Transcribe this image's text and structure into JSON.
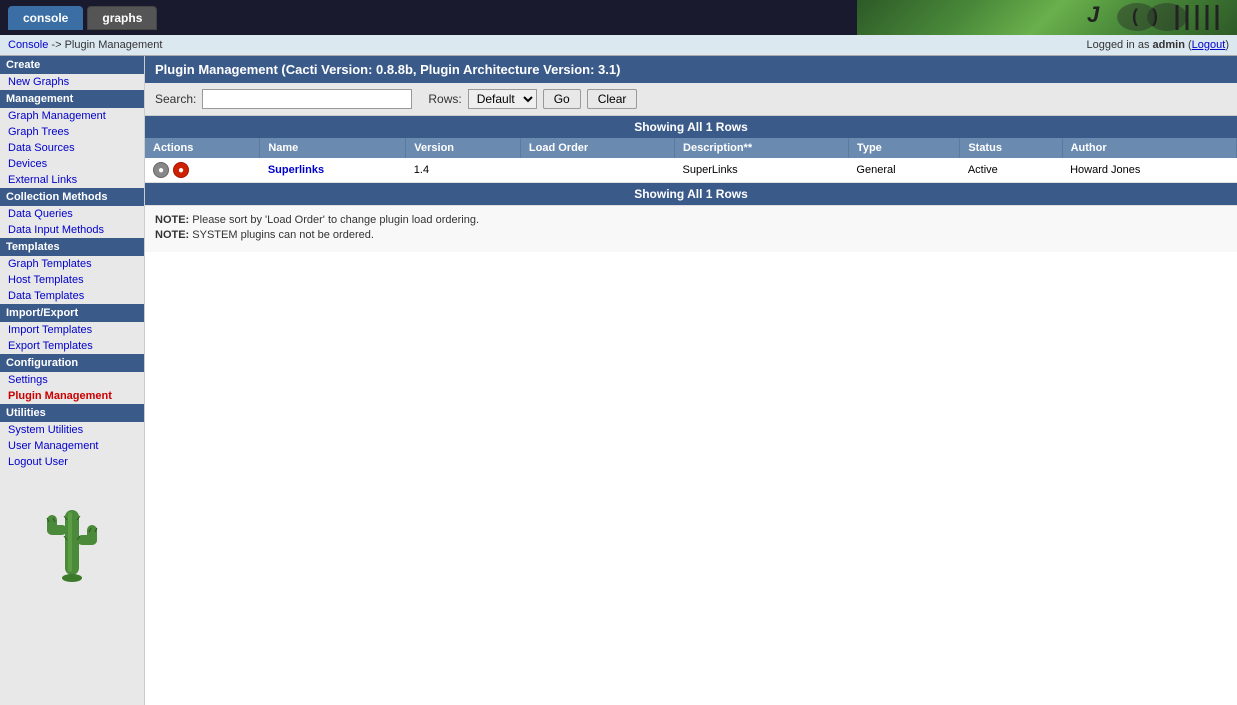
{
  "header": {
    "tab_console": "console",
    "tab_graphs": "graphs"
  },
  "breadcrumb": {
    "home": "Console",
    "separator": " -> ",
    "current": "Plugin Management"
  },
  "login": {
    "text": "Logged in as ",
    "username": "admin",
    "logout_label": "Logout"
  },
  "page_title": "Plugin Management (Cacti Version: 0.8.8b, Plugin Architecture Version: 3.1)",
  "search": {
    "label": "Search:",
    "placeholder": "",
    "rows_label": "Rows:",
    "rows_default": "Default",
    "go_label": "Go",
    "clear_label": "Clear"
  },
  "table": {
    "showing_label": "Showing All 1 Rows",
    "columns": [
      "Actions",
      "Name",
      "Version",
      "Load Order",
      "Description**",
      "Type",
      "Status",
      "Author"
    ],
    "rows": [
      {
        "name": "Superlinks",
        "version": "1.4",
        "load_order": "",
        "description": "SuperLinks",
        "type": "General",
        "status": "Active",
        "author": "Howard Jones"
      }
    ]
  },
  "notes": [
    "NOTE: Please sort by 'Load Order' to change plugin load ordering.",
    "NOTE: SYSTEM plugins can not be ordered."
  ],
  "sidebar": {
    "create_header": "Create",
    "new_graphs": "New Graphs",
    "management_header": "Management",
    "graph_management": "Graph Management",
    "graph_trees": "Graph Trees",
    "data_sources": "Data Sources",
    "devices": "Devices",
    "external_links": "External Links",
    "collection_header": "Collection Methods",
    "data_queries": "Data Queries",
    "data_input_methods": "Data Input Methods",
    "templates_header": "Templates",
    "graph_templates": "Graph Templates",
    "host_templates": "Host Templates",
    "data_templates": "Data Templates",
    "import_export_header": "Import/Export",
    "import_templates": "Import Templates",
    "export_templates": "Export Templates",
    "configuration_header": "Configuration",
    "settings": "Settings",
    "plugin_management": "Plugin Management",
    "utilities_header": "Utilities",
    "system_utilities": "System Utilities",
    "user_management": "User Management",
    "logout_user": "Logout User"
  }
}
